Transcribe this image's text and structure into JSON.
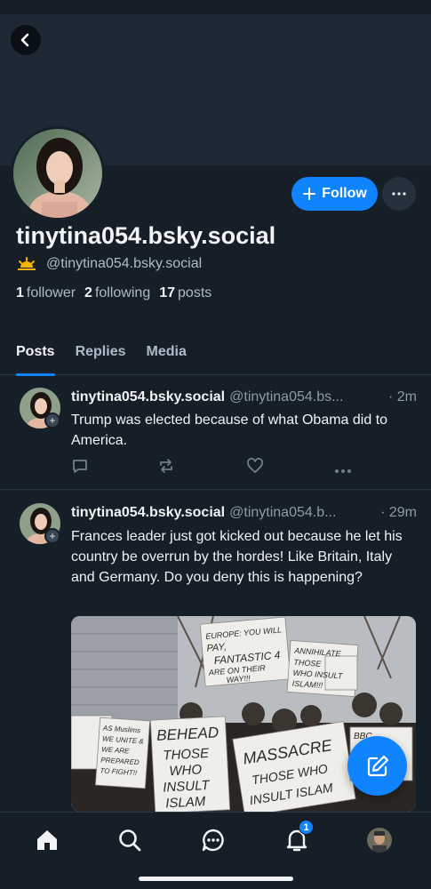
{
  "profile": {
    "display_name": "tinytina054.bsky.social",
    "handle": "@tinytina054.bsky.social",
    "follow_label": "Follow",
    "followers_count": "1",
    "followers_label": "follower",
    "following_count": "2",
    "following_label": "following",
    "posts_count": "17",
    "posts_label": "posts"
  },
  "tabs": [
    {
      "label": "Posts",
      "active": true
    },
    {
      "label": "Replies",
      "active": false
    },
    {
      "label": "Media",
      "active": false
    }
  ],
  "posts": [
    {
      "author": "tinytina054.bsky.social",
      "handle": "@tinytina054.bs...",
      "time": "· 2m",
      "text": "Trump was elected because of what Obama did to America."
    },
    {
      "author": "tinytina054.bsky.social",
      "handle": "@tinytina054.b...",
      "time": "· 29m",
      "text": "Frances leader just got kicked out because he let his country be overrun by the hordes! Like Britain, Italy and Germany. Do you deny this is happening?",
      "image_signs": [
        "EUROPE: YOU WILL PAY, FANTASTIC 4 ARE ON THEIR WAY!!!",
        "ANNIHILATE THOSE WHO INSULT ISLAM!!!",
        "BEHEAD THOSE WHO INSULT ISLAM",
        "MASSACRE THOSE WHO INSULT ISLAM",
        "AS MUSLIMS WE UNITE & WE ARE PREPARED TO FIGHT!!",
        "BBC"
      ]
    }
  ],
  "notifications_count": "1",
  "icons": {
    "back": "chevron-left-icon",
    "follow": "plus-icon",
    "more": "ellipsis-icon",
    "reply": "reply-icon",
    "repost": "repost-icon",
    "like": "heart-icon",
    "compose": "compose-icon",
    "home": "home-icon",
    "search": "search-icon",
    "chat": "chat-icon",
    "notifications": "bell-icon"
  },
  "colors": {
    "accent": "#1083fe",
    "background": "#161e27",
    "banner": "#1e2935",
    "muted_text": "#aebbc9"
  }
}
